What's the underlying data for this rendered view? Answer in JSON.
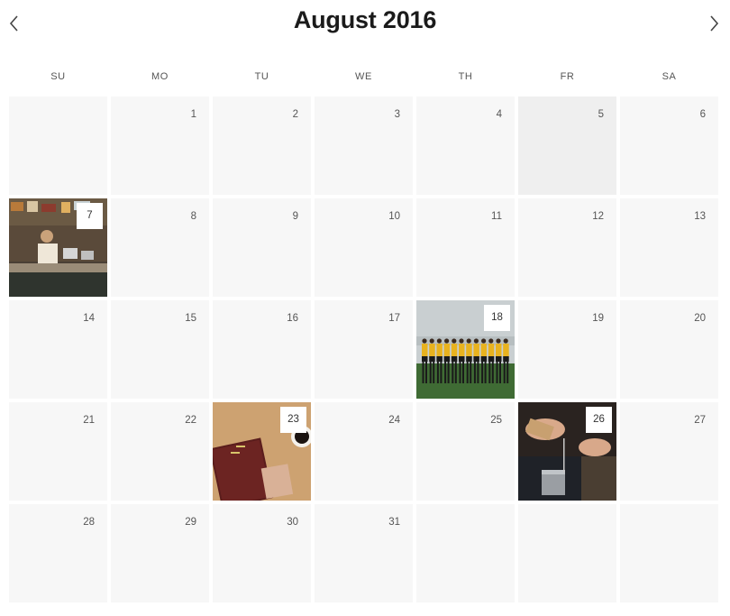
{
  "header": {
    "title": "August 2016",
    "prev_icon": "chevron-left-icon",
    "next_icon": "chevron-right-icon"
  },
  "weekdays": [
    "SU",
    "MO",
    "TU",
    "WE",
    "TH",
    "FR",
    "SA"
  ],
  "weeks": [
    [
      {
        "day": ""
      },
      {
        "day": "1"
      },
      {
        "day": "2"
      },
      {
        "day": "3"
      },
      {
        "day": "4"
      },
      {
        "day": "5",
        "highlight": true
      },
      {
        "day": "6"
      }
    ],
    [
      {
        "day": "7",
        "photo": "market-stall"
      },
      {
        "day": "8"
      },
      {
        "day": "9"
      },
      {
        "day": "10"
      },
      {
        "day": "11"
      },
      {
        "day": "12"
      },
      {
        "day": "13"
      }
    ],
    [
      {
        "day": "14"
      },
      {
        "day": "15"
      },
      {
        "day": "16"
      },
      {
        "day": "17"
      },
      {
        "day": "18",
        "photo": "team-on-field"
      },
      {
        "day": "19"
      },
      {
        "day": "20"
      }
    ],
    [
      {
        "day": "21"
      },
      {
        "day": "22"
      },
      {
        "day": "23",
        "photo": "desk-with-notebook"
      },
      {
        "day": "24"
      },
      {
        "day": "25"
      },
      {
        "day": "26",
        "photo": "bartender-pouring"
      },
      {
        "day": "27"
      }
    ],
    [
      {
        "day": "28"
      },
      {
        "day": "29"
      },
      {
        "day": "30"
      },
      {
        "day": "31"
      },
      {
        "day": ""
      },
      {
        "day": ""
      },
      {
        "day": ""
      }
    ]
  ],
  "colors": {
    "cell": "#f7f7f7",
    "cell_highlight": "#efefef",
    "title": "#1b1b1b"
  }
}
